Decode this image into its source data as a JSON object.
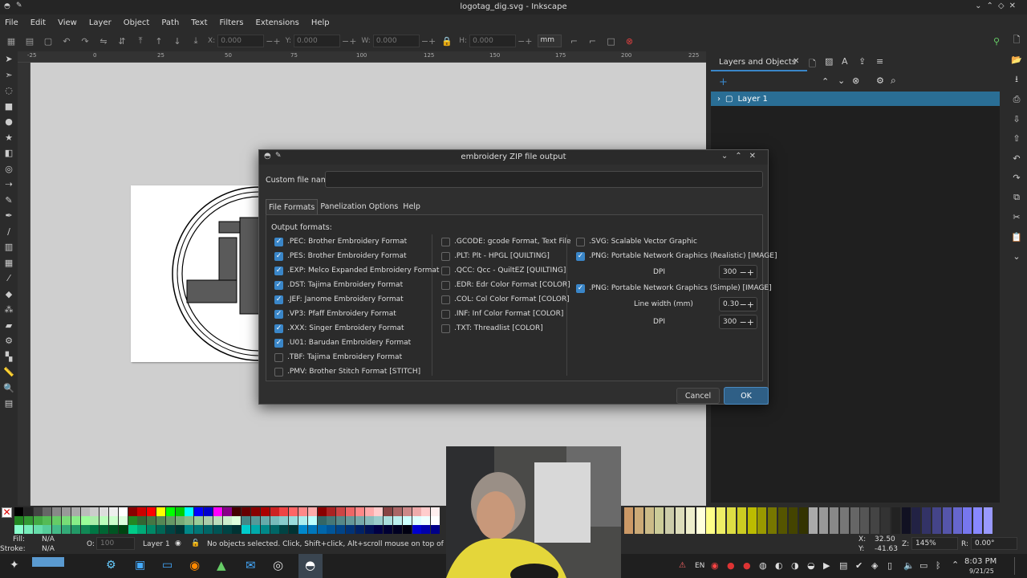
{
  "window": {
    "title": "logotag_dig.svg - Inkscape"
  },
  "menu": [
    "File",
    "Edit",
    "View",
    "Layer",
    "Object",
    "Path",
    "Text",
    "Filters",
    "Extensions",
    "Help"
  ],
  "toolbar": {
    "x_label": "X:",
    "x_value": "0.000",
    "y_label": "Y:",
    "y_value": "0.000",
    "w_label": "W:",
    "w_value": "0.000",
    "h_label": "H:",
    "h_value": "0.000",
    "unit": "mm"
  },
  "ruler_labels": [
    "-25",
    "0",
    "25",
    "50",
    "75",
    "100",
    "125",
    "150",
    "175",
    "200",
    "225"
  ],
  "layers_panel": {
    "tab_label": "Layers and Objects",
    "layer_name": "Layer 1"
  },
  "dialog": {
    "title": "embroidery ZIP file output",
    "custom_file_name_label": "Custom file name",
    "custom_file_name_value": "",
    "tabs": [
      "File Formats",
      "Panelization Options",
      "Help"
    ],
    "output_formats_label": "Output formats:",
    "col1": [
      {
        "label": ".PEC: Brother Embroidery Format",
        "checked": true
      },
      {
        "label": ".PES: Brother Embroidery Format",
        "checked": true
      },
      {
        "label": ".EXP: Melco Expanded Embroidery Format",
        "checked": true
      },
      {
        "label": ".DST: Tajima Embroidery Format",
        "checked": true
      },
      {
        "label": ".JEF: Janome Embroidery Format",
        "checked": true
      },
      {
        "label": ".VP3: Pfaff Embroidery Format",
        "checked": true
      },
      {
        "label": ".XXX: Singer Embroidery Format",
        "checked": true
      },
      {
        "label": ".U01: Barudan Embroidery Format",
        "checked": true
      },
      {
        "label": ".TBF: Tajima Embroidery Format",
        "checked": false
      },
      {
        "label": ".PMV: Brother Stitch Format [STITCH]",
        "checked": false
      }
    ],
    "col2": [
      {
        "label": ".GCODE: gcode Format, Text File",
        "checked": false
      },
      {
        "label": ".PLT: Plt - HPGL [QUILTING]",
        "checked": false
      },
      {
        "label": ".QCC: Qcc - QuiltEZ [QUILTING]",
        "checked": false
      },
      {
        "label": ".EDR: Edr Color Format [COLOR]",
        "checked": false
      },
      {
        "label": ".COL: Col Color Format [COLOR]",
        "checked": false
      },
      {
        "label": ".INF: Inf Color Format [COLOR]",
        "checked": false
      },
      {
        "label": ".TXT: Threadlist [COLOR]",
        "checked": false
      }
    ],
    "col3": {
      "svg": {
        "label": ".SVG: Scalable Vector Graphic",
        "checked": false
      },
      "png_realistic": {
        "label": ".PNG: Portable Network Graphics (Realistic) [IMAGE]",
        "checked": true
      },
      "dpi1_label": "DPI",
      "dpi1_value": "300",
      "png_simple": {
        "label": ".PNG: Portable Network Graphics (Simple) [IMAGE]",
        "checked": true
      },
      "line_width_label": "Line width (mm)",
      "line_width_value": "0.30",
      "dpi2_label": "DPI",
      "dpi2_value": "300"
    },
    "cancel_label": "Cancel",
    "ok_label": "OK"
  },
  "status": {
    "fill_label": "Fill:",
    "fill_value": "N/A",
    "stroke_label": "Stroke:",
    "stroke_value": "N/A",
    "opacity_label": "O:",
    "opacity_value": "100",
    "layer": "Layer 1",
    "message": "No objects selected. Click, Shift+click, Alt+scroll mouse on top of objects, o",
    "x_label": "X:",
    "x_value": "32.50",
    "y_label": "Y:",
    "y_value": "-41.63",
    "zoom_label": "Z:",
    "zoom_value": "145%",
    "rot_label": "R:",
    "rot_value": "0.00°"
  },
  "taskbar": {
    "lang": "EN",
    "time": "8:03 PM",
    "date": "9/21/25"
  }
}
